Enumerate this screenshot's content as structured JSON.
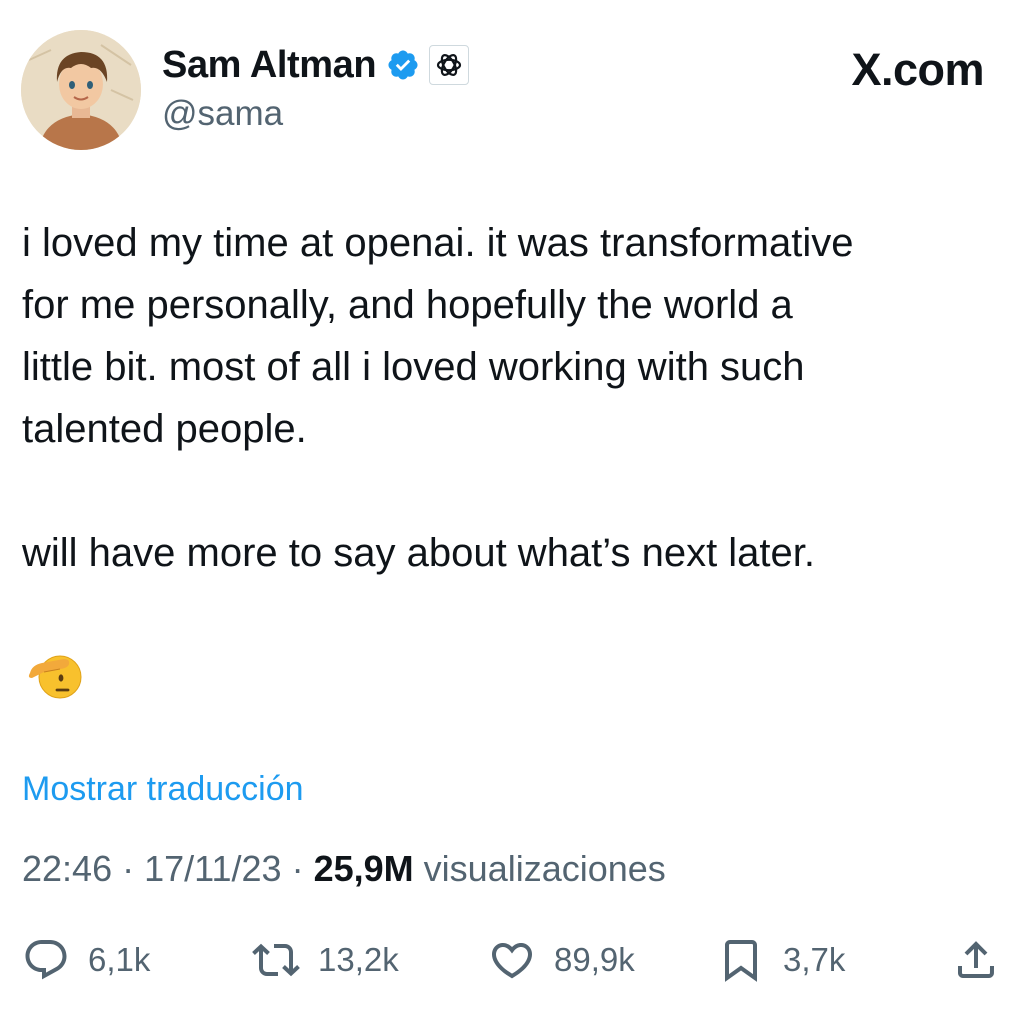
{
  "profile": {
    "name": "Sam Altman",
    "handle": "@sama",
    "verified_color": "#1d9bf0"
  },
  "brand": "X.com",
  "tweet": {
    "paragraph1": "i loved my time at openai. it was transformative\nfor me personally, and hopefully the world a\nlittle bit. most of all i loved working with such\ntalented people.",
    "paragraph2": "will have more to say about what’s next later.",
    "emoji": "saluting-face"
  },
  "translate_link": "Mostrar traducción",
  "meta": {
    "time": "22:46",
    "date": "17/11/23",
    "views_count": "25,9M",
    "views_label": "visualizaciones"
  },
  "actions": {
    "replies": "6,1k",
    "reposts": "13,2k",
    "likes": "89,9k",
    "bookmarks": "3,7k"
  },
  "colors": {
    "link": "#1d9bf0",
    "secondary_text": "#536471",
    "primary_text": "#0f1419"
  }
}
